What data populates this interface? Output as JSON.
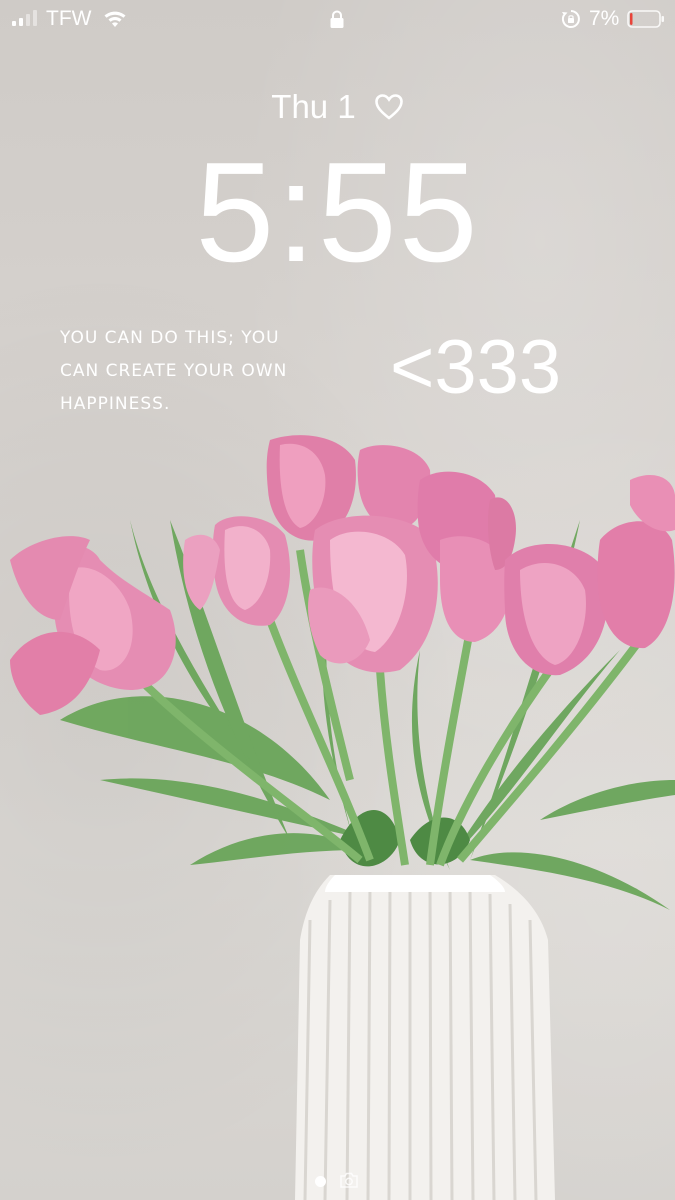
{
  "status_bar": {
    "carrier": "TFW",
    "battery_percent": "7%",
    "battery_level": 0.07,
    "signal_bars_filled": 2,
    "signal_bars_total": 4,
    "icons": [
      "signal-icon",
      "wifi-icon",
      "lock-icon",
      "rotation-lock-icon",
      "battery-icon"
    ]
  },
  "lock_screen": {
    "date": "Thu 1",
    "time": "5:55",
    "widget_icon": "heart-icon"
  },
  "wallpaper": {
    "quote_lines": [
      "YOU CAN DO THIS; YOU",
      "CAN CREATE YOUR OWN",
      "HAPPINESS."
    ],
    "hearts_text": "<333"
  },
  "footer": {
    "page_indicator": "page-dot",
    "camera_icon": "camera-icon"
  },
  "colors": {
    "accent": "#ffffff",
    "tulip_pink": "#e88ab0",
    "stem_green": "#5e9a52",
    "battery_low": "#e8443a"
  }
}
